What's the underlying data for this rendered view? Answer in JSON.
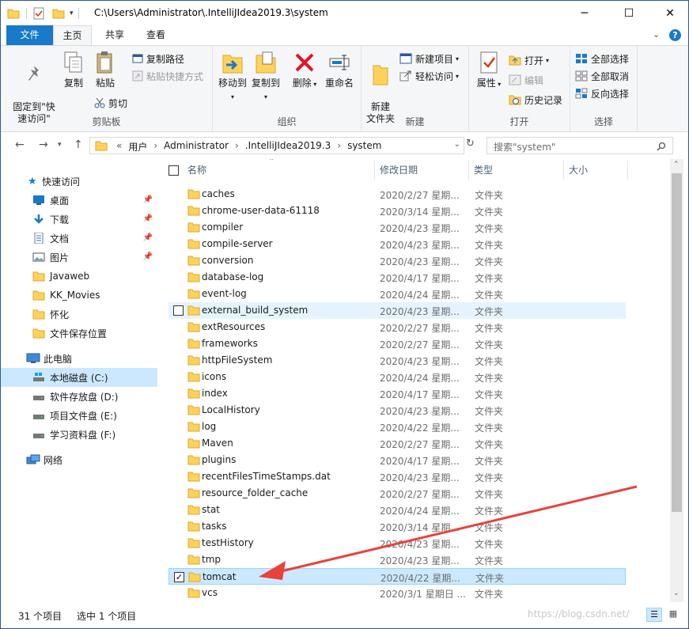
{
  "window": {
    "title": "C:\\Users\\Administrator\\.IntelliJIdea2019.3\\system",
    "minimize": "─",
    "maximize": "☐",
    "close": "✕"
  },
  "tabs": [
    {
      "label": "文件"
    },
    {
      "label": "主页"
    },
    {
      "label": "共享"
    },
    {
      "label": "查看"
    }
  ],
  "ribbon": {
    "clipboard": {
      "pin_label": "固定到\"快\n速访问\"",
      "copy_label": "复制",
      "paste_label": "粘贴",
      "copy_path": "复制路径",
      "paste_shortcut": "粘贴快捷方式",
      "cut": "剪切",
      "group": "剪贴板"
    },
    "organize": {
      "move_to": "移动到",
      "copy_to": "复制到",
      "delete": "删除",
      "rename": "重命名",
      "group": "组织"
    },
    "new": {
      "new_folder": "新建\n文件夹",
      "new_item": "新建项目",
      "easy_access": "轻松访问",
      "group": "新建"
    },
    "open": {
      "properties": "属性",
      "open": "打开",
      "edit": "编辑",
      "history": "历史记录",
      "group": "打开"
    },
    "select": {
      "select_all": "全部选择",
      "select_none": "全部取消",
      "invert": "反向选择",
      "group": "选择"
    }
  },
  "address": {
    "prefix": "«",
    "crumbs": [
      "用户",
      "Administrator",
      ".IntelliJIdea2019.3",
      "system"
    ],
    "search_placeholder": "搜索\"system\""
  },
  "nav": {
    "quick_access": "快速访问",
    "items": [
      {
        "label": "桌面",
        "pinned": true
      },
      {
        "label": "下载",
        "pinned": true
      },
      {
        "label": "文档",
        "pinned": true
      },
      {
        "label": "图片",
        "pinned": true
      },
      {
        "label": "Javaweb",
        "pinned": false
      },
      {
        "label": "KK_Movies",
        "pinned": false
      },
      {
        "label": "怀化",
        "pinned": false
      },
      {
        "label": "文件保存位置",
        "pinned": false
      }
    ],
    "this_pc": "此电脑",
    "drives": [
      {
        "label": "本地磁盘 (C:)"
      },
      {
        "label": "软件存放盘 (D:)"
      },
      {
        "label": "项目文件盘 (E:)"
      },
      {
        "label": "学习资料盘 (F:)"
      }
    ],
    "network": "网络"
  },
  "columns": {
    "name": "名称",
    "date": "修改日期",
    "type": "类型",
    "size": "大小"
  },
  "files": [
    {
      "name": "caches",
      "date": "2020/2/27 星期...",
      "type": "文件夹"
    },
    {
      "name": "chrome-user-data-61118",
      "date": "2020/3/14 星期...",
      "type": "文件夹"
    },
    {
      "name": "compiler",
      "date": "2020/4/23 星期...",
      "type": "文件夹"
    },
    {
      "name": "compile-server",
      "date": "2020/4/23 星期...",
      "type": "文件夹"
    },
    {
      "name": "conversion",
      "date": "2020/4/23 星期...",
      "type": "文件夹"
    },
    {
      "name": "database-log",
      "date": "2020/4/17 星期...",
      "type": "文件夹"
    },
    {
      "name": "event-log",
      "date": "2020/4/24 星期...",
      "type": "文件夹"
    },
    {
      "name": "external_build_system",
      "date": "2020/4/23 星期...",
      "type": "文件夹"
    },
    {
      "name": "extResources",
      "date": "2020/2/27 星期...",
      "type": "文件夹"
    },
    {
      "name": "frameworks",
      "date": "2020/2/27 星期...",
      "type": "文件夹"
    },
    {
      "name": "httpFileSystem",
      "date": "2020/4/23 星期...",
      "type": "文件夹"
    },
    {
      "name": "icons",
      "date": "2020/4/24 星期...",
      "type": "文件夹"
    },
    {
      "name": "index",
      "date": "2020/4/17 星期...",
      "type": "文件夹"
    },
    {
      "name": "LocalHistory",
      "date": "2020/4/23 星期...",
      "type": "文件夹"
    },
    {
      "name": "log",
      "date": "2020/4/22 星期...",
      "type": "文件夹"
    },
    {
      "name": "Maven",
      "date": "2020/2/27 星期...",
      "type": "文件夹"
    },
    {
      "name": "plugins",
      "date": "2020/4/17 星期...",
      "type": "文件夹"
    },
    {
      "name": "recentFilesTimeStamps.dat",
      "date": "2020/4/23 星期...",
      "type": "文件夹"
    },
    {
      "name": "resource_folder_cache",
      "date": "2020/2/27 星期...",
      "type": "文件夹"
    },
    {
      "name": "stat",
      "date": "2020/4/24 星期...",
      "type": "文件夹"
    },
    {
      "name": "tasks",
      "date": "2020/3/14 星期...",
      "type": "文件夹"
    },
    {
      "name": "testHistory",
      "date": "2020/4/23 星期...",
      "type": "文件夹"
    },
    {
      "name": "tmp",
      "date": "2020/4/23 星期...",
      "type": "文件夹"
    },
    {
      "name": "tomcat",
      "date": "2020/4/22 星期...",
      "type": "文件夹"
    },
    {
      "name": "vcs",
      "date": "2020/3/1 星期日 ...",
      "type": "文件夹"
    }
  ],
  "status": {
    "count": "31 个项目",
    "selected": "选中 1 个项目"
  },
  "watermark": "https://blog.csdn.net/",
  "colors": {
    "accent": "#1979ca",
    "selection": "#cce8ff",
    "folder": "#ffd25c",
    "arrow": "#e8423a"
  }
}
